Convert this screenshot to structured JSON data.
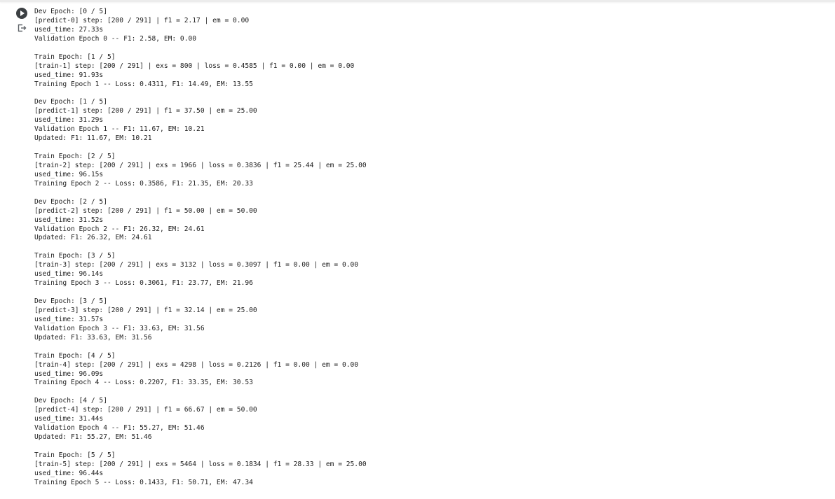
{
  "cell": {
    "run_button_icon": "play-circle-icon",
    "output_icon": "output-redirect-icon"
  },
  "output_lines": [
    "Dev Epoch: [0 / 5]",
    "[predict-0] step: [200 / 291] | f1 = 2.17 | em = 0.00",
    "used_time: 27.33s",
    "Validation Epoch 0 -- F1: 2.58, EM: 0.00",
    "",
    "Train Epoch: [1 / 5]",
    "[train-1] step: [200 / 291] | exs = 800 | loss = 0.4585 | f1 = 0.00 | em = 0.00",
    "used_time: 91.93s",
    "Training Epoch 1 -- Loss: 0.4311, F1: 14.49, EM: 13.55",
    "",
    "Dev Epoch: [1 / 5]",
    "[predict-1] step: [200 / 291] | f1 = 37.50 | em = 25.00",
    "used_time: 31.29s",
    "Validation Epoch 1 -- F1: 11.67, EM: 10.21",
    "Updated: F1: 11.67, EM: 10.21",
    "",
    "Train Epoch: [2 / 5]",
    "[train-2] step: [200 / 291] | exs = 1966 | loss = 0.3836 | f1 = 25.44 | em = 25.00",
    "used_time: 96.15s",
    "Training Epoch 2 -- Loss: 0.3586, F1: 21.35, EM: 20.33",
    "",
    "Dev Epoch: [2 / 5]",
    "[predict-2] step: [200 / 291] | f1 = 50.00 | em = 50.00",
    "used_time: 31.52s",
    "Validation Epoch 2 -- F1: 26.32, EM: 24.61",
    "Updated: F1: 26.32, EM: 24.61",
    "",
    "Train Epoch: [3 / 5]",
    "[train-3] step: [200 / 291] | exs = 3132 | loss = 0.3097 | f1 = 0.00 | em = 0.00",
    "used_time: 96.14s",
    "Training Epoch 3 -- Loss: 0.3061, F1: 23.77, EM: 21.96",
    "",
    "Dev Epoch: [3 / 5]",
    "[predict-3] step: [200 / 291] | f1 = 32.14 | em = 25.00",
    "used_time: 31.57s",
    "Validation Epoch 3 -- F1: 33.63, EM: 31.56",
    "Updated: F1: 33.63, EM: 31.56",
    "",
    "Train Epoch: [4 / 5]",
    "[train-4] step: [200 / 291] | exs = 4298 | loss = 0.2126 | f1 = 0.00 | em = 0.00",
    "used_time: 96.09s",
    "Training Epoch 4 -- Loss: 0.2207, F1: 33.35, EM: 30.53",
    "",
    "Dev Epoch: [4 / 5]",
    "[predict-4] step: [200 / 291] | f1 = 66.67 | em = 50.00",
    "used_time: 31.44s",
    "Validation Epoch 4 -- F1: 55.27, EM: 51.46",
    "Updated: F1: 55.27, EM: 51.46",
    "",
    "Train Epoch: [5 / 5]",
    "[train-5] step: [200 / 291] | exs = 5464 | loss = 0.1834 | f1 = 28.33 | em = 25.00",
    "used_time: 96.44s",
    "Training Epoch 5 -- Loss: 0.1433, F1: 50.71, EM: 47.34"
  ]
}
